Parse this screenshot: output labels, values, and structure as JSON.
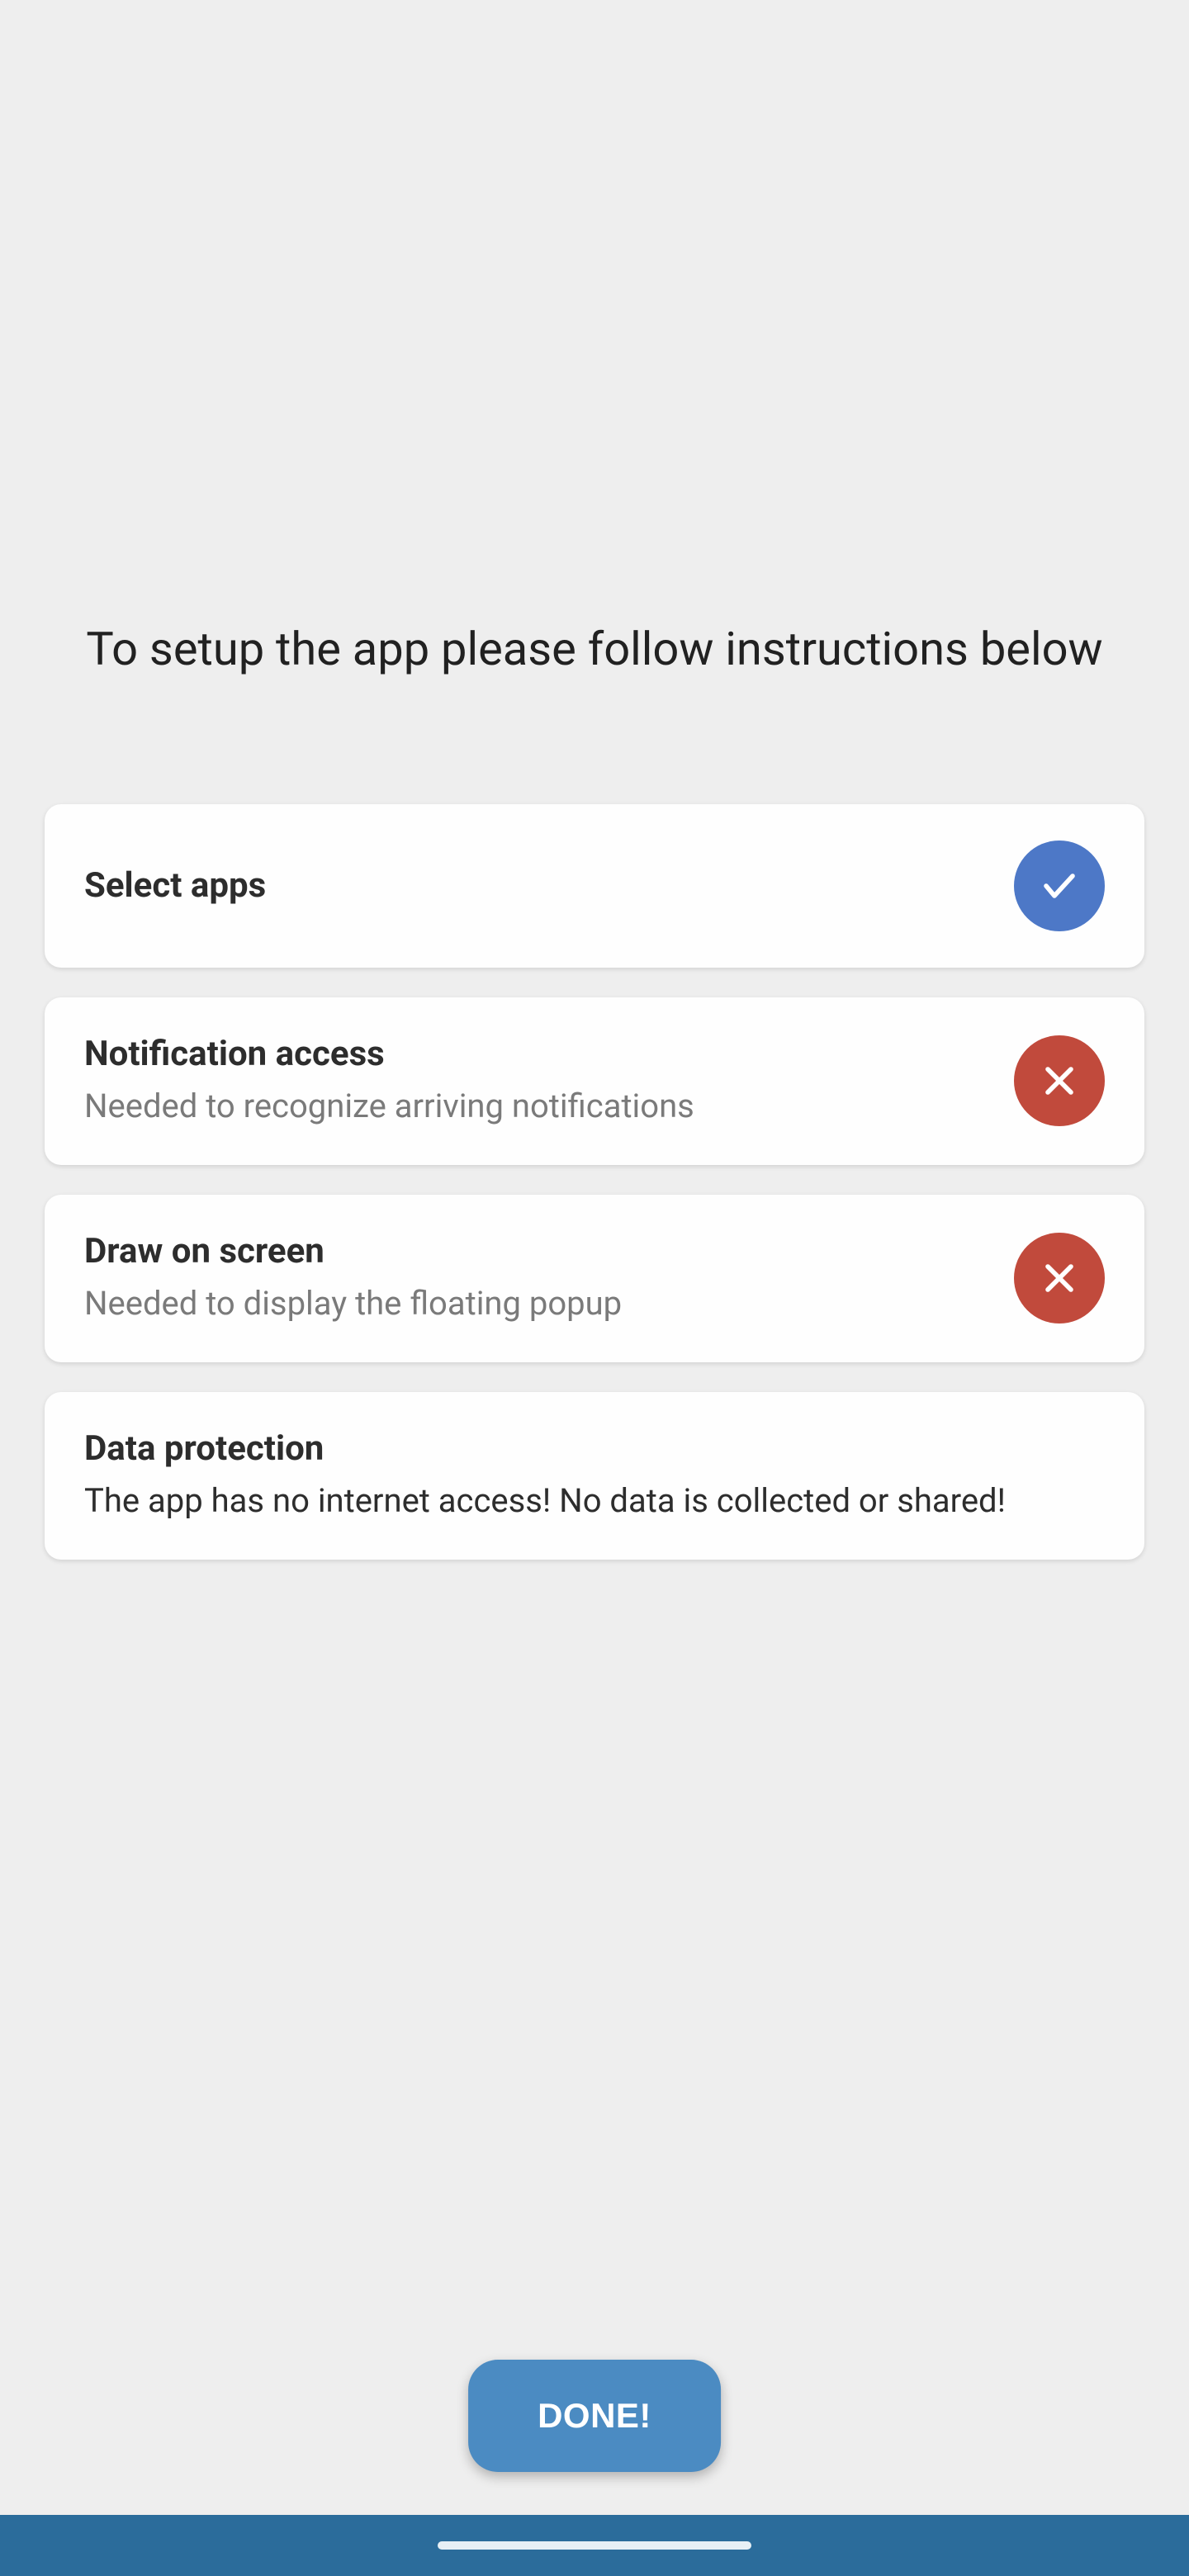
{
  "heading": "To setup the app please follow instructions below",
  "cards": [
    {
      "title": "Select apps",
      "subtitle": "",
      "status": "ok"
    },
    {
      "title": "Notification access",
      "subtitle": "Needed to recognize arriving notifications",
      "status": "no"
    },
    {
      "title": "Draw on screen",
      "subtitle": "Needed to display the floating popup",
      "status": "no"
    },
    {
      "title": "Data protection",
      "subtitle": "The app has no internet access! No data is collected or shared!",
      "status": "none"
    }
  ],
  "done_label": "DONE!"
}
